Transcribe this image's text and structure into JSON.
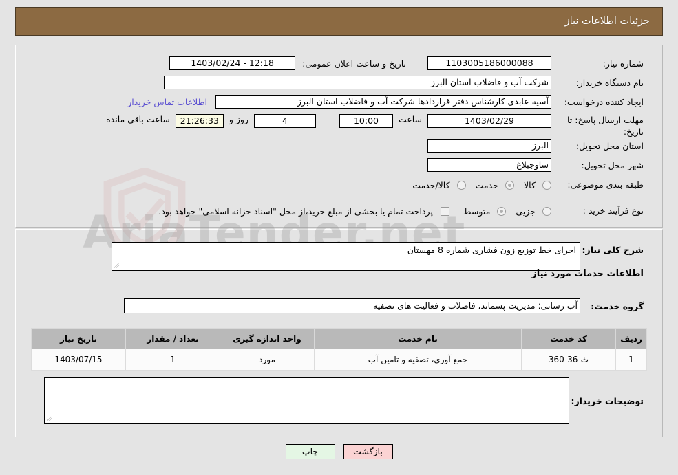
{
  "header": {
    "title": "جزئیات اطلاعات نیاز",
    "bg_color": "#8c6a42"
  },
  "watermark": {
    "text": "AriaTender.net"
  },
  "form": {
    "need_number": {
      "label": "شماره نیاز:",
      "value": "1103005186000088"
    },
    "public_announce": {
      "label": "تاریخ و ساعت اعلان عمومی:",
      "value": "12:18 - 1403/02/24"
    },
    "buyer_org": {
      "label": "نام دستگاه خریدار:",
      "value": "شرکت آب و فاضلاب استان البرز"
    },
    "requester": {
      "label": "ایجاد کننده درخواست:",
      "value": "آسیه عابدی کارشناس دفتر قراردادها شرکت آب و فاضلاب استان البرز",
      "contact_link": "اطلاعات تماس خریدار"
    },
    "deadline": {
      "label": "مهلت ارسال پاسخ: تا تاریخ:",
      "date": "1403/02/29",
      "time_label": "ساعت",
      "time": "10:00",
      "days": "4",
      "days_label": "روز و",
      "countdown": "21:26:33",
      "remaining_label": "ساعت باقی مانده"
    },
    "province": {
      "label": "استان محل تحویل:",
      "value": "البرز"
    },
    "city": {
      "label": "شهر محل تحویل:",
      "value": "ساوجبلاغ"
    },
    "category": {
      "label": "طبقه بندی موضوعی:",
      "options": [
        {
          "label": "کالا",
          "selected": false
        },
        {
          "label": "خدمت",
          "selected": true
        },
        {
          "label": "کالا/خدمت",
          "selected": false
        }
      ]
    },
    "process_type": {
      "label": "نوع فرآیند خرید :",
      "options": [
        {
          "label": "جزیی",
          "selected": false
        },
        {
          "label": "متوسط",
          "selected": true
        }
      ],
      "treasury_checkbox_label": "پرداخت تمام یا بخشی از مبلغ خرید،از محل \"اسناد خزانه اسلامی\" خواهد بود.",
      "treasury_checked": false
    },
    "general_description": {
      "label": "شرح کلی نیاز:",
      "value": "اجرای خط توزیع زون فشاری شماره 8 مهستان"
    },
    "services_section_title": "اطلاعات خدمات مورد نیاز",
    "service_group": {
      "label": "گروه خدمت:",
      "value": "آب رسانی؛ مدیریت پسماند، فاضلاب و فعالیت های تصفیه"
    },
    "buyer_notes": {
      "label": "توضیحات خریدار:",
      "value": ""
    }
  },
  "table": {
    "columns": [
      "ردیف",
      "کد خدمت",
      "نام خدمت",
      "واحد اندازه گیری",
      "تعداد / مقدار",
      "تاریخ نیاز"
    ],
    "rows": [
      {
        "row_no": "1",
        "service_code": "ث-36-360",
        "service_name": "جمع آوری، تصفیه و تامین آب",
        "unit": "مورد",
        "quantity": "1",
        "need_date": "1403/07/15"
      }
    ]
  },
  "footer": {
    "buttons": [
      {
        "label": "بازگشت",
        "kind": "back"
      },
      {
        "label": "چاپ",
        "kind": "print"
      }
    ]
  }
}
